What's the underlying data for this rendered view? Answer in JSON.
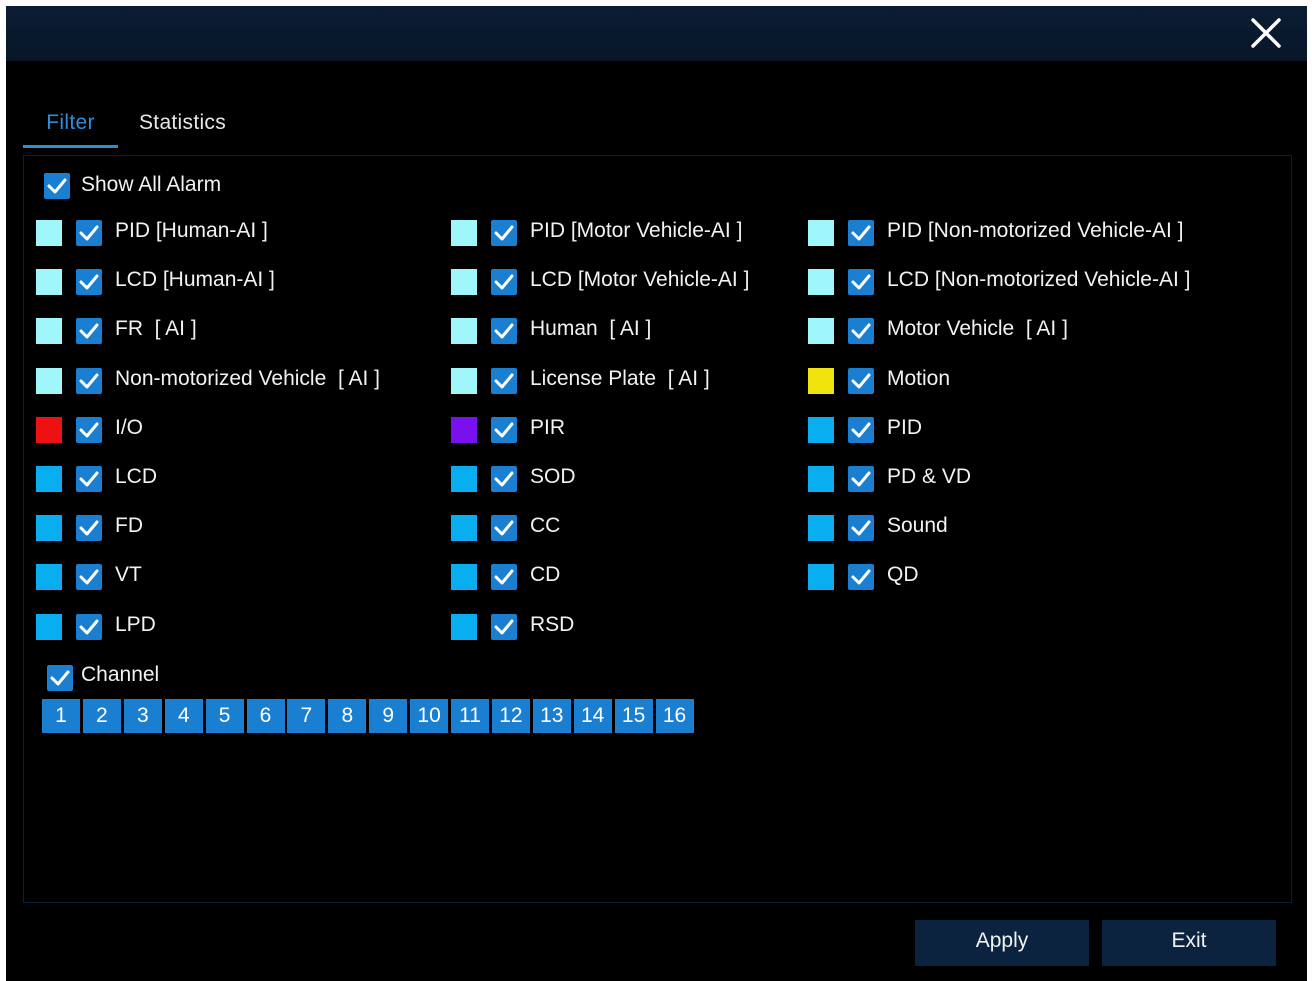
{
  "tabs": [
    {
      "label": "Filter",
      "active": true
    },
    {
      "label": "Statistics",
      "active": false
    }
  ],
  "show_all": {
    "label": "Show All Alarm",
    "checked": true
  },
  "alarm_columns": [
    [
      {
        "label": "PID [Human-AI ]",
        "color": "#9ff7fb",
        "checked": true
      },
      {
        "label": "LCD [Human-AI ]",
        "color": "#9ff7fb",
        "checked": true
      },
      {
        "label": "FR  [ AI ]",
        "color": "#9ff7fb",
        "checked": true
      },
      {
        "label": "Non-motorized Vehicle  [ AI ]",
        "color": "#9ff7fb",
        "checked": true
      },
      {
        "label": "I/O",
        "color": "#ee1111",
        "checked": true
      },
      {
        "label": "LCD",
        "color": "#09aef0",
        "checked": true
      },
      {
        "label": "FD",
        "color": "#09aef0",
        "checked": true
      },
      {
        "label": "VT",
        "color": "#09aef0",
        "checked": true
      },
      {
        "label": "LPD",
        "color": "#09aef0",
        "checked": true
      }
    ],
    [
      {
        "label": "PID [Motor Vehicle-AI ]",
        "color": "#9ff7fb",
        "checked": true
      },
      {
        "label": "LCD [Motor Vehicle-AI ]",
        "color": "#9ff7fb",
        "checked": true
      },
      {
        "label": "Human  [ AI ]",
        "color": "#9ff7fb",
        "checked": true
      },
      {
        "label": "License Plate  [ AI ]",
        "color": "#9ff7fb",
        "checked": true
      },
      {
        "label": "PIR",
        "color": "#7a10f0",
        "checked": true
      },
      {
        "label": "SOD",
        "color": "#09aef0",
        "checked": true
      },
      {
        "label": "CC",
        "color": "#09aef0",
        "checked": true
      },
      {
        "label": "CD",
        "color": "#09aef0",
        "checked": true
      },
      {
        "label": "RSD",
        "color": "#09aef0",
        "checked": true
      }
    ],
    [
      {
        "label": "PID [Non-motorized Vehicle-AI ]",
        "color": "#9ff7fb",
        "checked": true
      },
      {
        "label": "LCD [Non-motorized Vehicle-AI ]",
        "color": "#9ff7fb",
        "checked": true
      },
      {
        "label": "Motor Vehicle  [ AI ]",
        "color": "#9ff7fb",
        "checked": true
      },
      {
        "label": "Motion",
        "color": "#f1e30d",
        "checked": true
      },
      {
        "label": "PID",
        "color": "#09aef0",
        "checked": true
      },
      {
        "label": "PD & VD",
        "color": "#09aef0",
        "checked": true
      },
      {
        "label": "Sound",
        "color": "#09aef0",
        "checked": true
      },
      {
        "label": "QD",
        "color": "#09aef0",
        "checked": true
      }
    ]
  ],
  "channel": {
    "label": "Channel",
    "checked": true,
    "numbers": [
      "1",
      "2",
      "3",
      "4",
      "5",
      "6",
      "7",
      "8",
      "9",
      "10",
      "11",
      "12",
      "13",
      "14",
      "15",
      "16"
    ]
  },
  "buttons": {
    "apply": "Apply",
    "exit": "Exit"
  },
  "icons": {
    "close": "close-icon",
    "check": "check-icon"
  },
  "colors": {
    "accent": "#1a7fd1",
    "tab_active": "#2a8fd6",
    "button_bg": "#0c2340",
    "titlebar": "#0b1d33"
  }
}
